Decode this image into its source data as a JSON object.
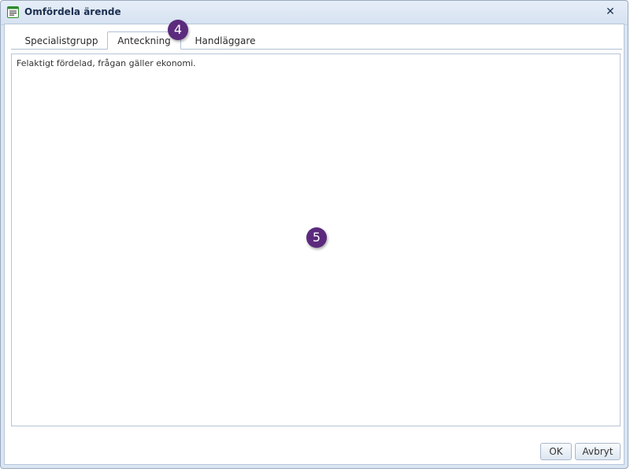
{
  "window": {
    "title": "Omfördela ärende",
    "close_glyph": "✕"
  },
  "tabs": [
    {
      "label": "Specialistgrupp",
      "active": false
    },
    {
      "label": "Anteckning",
      "active": true
    },
    {
      "label": "Handläggare",
      "active": false
    }
  ],
  "note": {
    "value": "Felaktigt fördelad, frågan gäller ekonomi."
  },
  "annotations": [
    {
      "number": "4"
    },
    {
      "number": "5"
    }
  ],
  "buttons": {
    "ok_label": "OK",
    "cancel_label": "Avbryt"
  },
  "colors": {
    "badge": "#5b2a7d",
    "title_text": "#1b2f4e",
    "app_icon_green": "#2e8b2e"
  },
  "icons": {
    "app": "form-list-icon",
    "close": "close-icon"
  }
}
